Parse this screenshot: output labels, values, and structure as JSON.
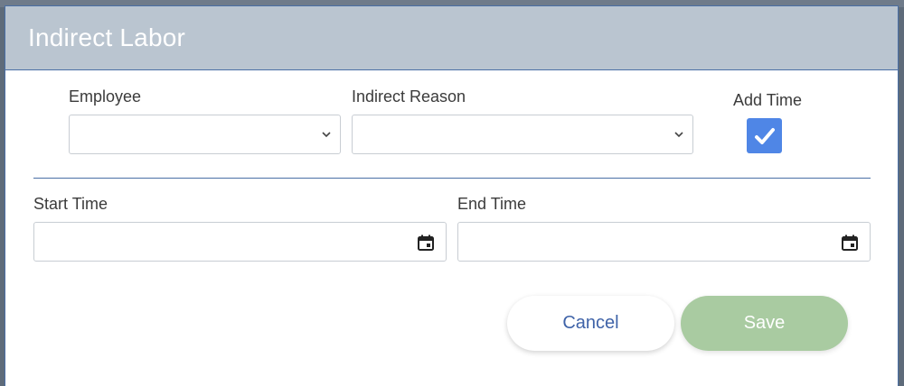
{
  "dialog": {
    "title": "Indirect Labor"
  },
  "fields": {
    "employee": {
      "label": "Employee",
      "value": ""
    },
    "indirect_reason": {
      "label": "Indirect Reason",
      "value": ""
    },
    "add_time": {
      "label": "Add Time",
      "checked": true
    },
    "start_time": {
      "label": "Start Time",
      "value": ""
    },
    "end_time": {
      "label": "End Time",
      "value": ""
    }
  },
  "buttons": {
    "cancel": "Cancel",
    "save": "Save"
  },
  "colors": {
    "header_bg": "#bac5d0",
    "accent_border": "#4a6fa5",
    "checkbox_bg": "#4f86e6",
    "cancel_text": "#3f63a8",
    "save_bg": "#a9cba1"
  },
  "icons": {
    "select_chevron": "chevron-down-icon",
    "date_picker": "calendar-icon",
    "checkbox_mark": "checkmark-icon"
  }
}
